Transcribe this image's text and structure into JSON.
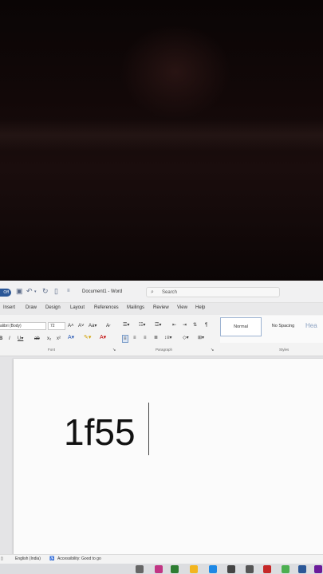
{
  "titlebar": {
    "autosave_label": "Off",
    "doc_title": "Document1 - Word",
    "search_placeholder": "Search"
  },
  "tabs": [
    {
      "label": "Insert"
    },
    {
      "label": "Draw"
    },
    {
      "label": "Design"
    },
    {
      "label": "Layout"
    },
    {
      "label": "References"
    },
    {
      "label": "Mailings"
    },
    {
      "label": "Review"
    },
    {
      "label": "View"
    },
    {
      "label": "Help"
    }
  ],
  "ribbon": {
    "font_name": "alibri (Body)",
    "font_size": "72",
    "groups": {
      "font": "Font",
      "paragraph": "Paragraph",
      "styles": "Styles"
    },
    "styles": {
      "normal": "Normal",
      "no_spacing": "No Spacing",
      "heading": "Hea"
    }
  },
  "document": {
    "text": "1f55"
  },
  "statusbar": {
    "language": "English (India)",
    "accessibility": "Accessibility: Good to go"
  },
  "colors": {
    "accent": "#2b5797",
    "page": "#fbfbfb",
    "ribbon": "#f3f3f3"
  }
}
